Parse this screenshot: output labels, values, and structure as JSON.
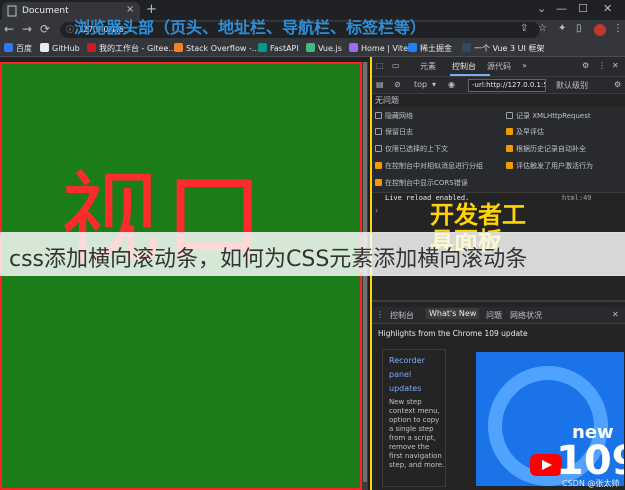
{
  "browser": {
    "tab_title": "Document",
    "tab_close": "×",
    "new_tab": "+",
    "window_controls": [
      "⌄",
      "—",
      "☐",
      "✕"
    ],
    "nav": {
      "back": "←",
      "forward": "→",
      "reload": "⟳"
    },
    "omnibox_text": "127.0.0.1:5...",
    "chrome_caption": "浏览器头部（页头、地址栏、导航栏、标签栏等）",
    "toolbar_icons": [
      "share",
      "star",
      "extensions",
      "sidebar",
      "profile",
      "menu"
    ],
    "bookmarks": [
      {
        "label": "百度",
        "color": "#3077f0"
      },
      {
        "label": "GitHub",
        "color": "#e8eaed"
      },
      {
        "label": "我的工作台 - Gitee...",
        "color": "#c71d23"
      },
      {
        "label": "Stack Overflow -...",
        "color": "#f48024"
      },
      {
        "label": "FastAPI",
        "color": "#05998b"
      },
      {
        "label": "Vue.js",
        "color": "#42b883"
      },
      {
        "label": "Home | Vite",
        "color": "#9b6bff"
      },
      {
        "label": "稀土掘金",
        "color": "#1e80ff"
      },
      {
        "label": "一个 Vue 3 UI 框架",
        "color": "#34495e"
      }
    ]
  },
  "viewport": {
    "label": "视口",
    "border_color": "#ff2222",
    "background": "#1a7d1a"
  },
  "devtools": {
    "tabs": [
      "元素",
      "控制台",
      "源代码"
    ],
    "active_tab": "控制台",
    "toolbar": {
      "context": "top",
      "filter_value": "-url:http://127.0.0.1:5",
      "levels": "默认级别"
    },
    "no_issues": "无问题",
    "options_left": [
      {
        "label": "隐藏网络",
        "checked": false
      },
      {
        "label": "保留日志",
        "checked": false
      },
      {
        "label": "仅限已选择的上下文",
        "checked": false
      },
      {
        "label": "在控制台中对相似消息进行分组",
        "checked": true
      },
      {
        "label": "在控制台中显示CORS错误",
        "checked": true
      }
    ],
    "options_right": [
      {
        "label": "记录 XMLHttpRequest",
        "checked": false
      },
      {
        "label": "及早评估",
        "checked": true
      },
      {
        "label": "根据历史记录自动补全",
        "checked": true
      },
      {
        "label": "评估触发了用户激活行为",
        "checked": true
      }
    ],
    "console_line": "Live reload enabled.",
    "console_source": "html:49",
    "label": "开发者工具面板",
    "drawer_tabs": [
      "控制台",
      "What's New",
      "问题",
      "网络状况"
    ],
    "drawer_active": "What's New",
    "whats_new_heading": "Highlights from the Chrome 109 update",
    "whats_new_links": [
      "Recorder",
      "panel",
      "updates"
    ],
    "whats_new_body": "New step context menu, option to copy a single step from a script, remove the first navigation step, and more.",
    "banner_new": "new",
    "banner_version": "109"
  },
  "watermark": "css添加横向滚动条，如何为CSS元素添加横向滚动条",
  "footer_credit": "CSDN @张太帅"
}
